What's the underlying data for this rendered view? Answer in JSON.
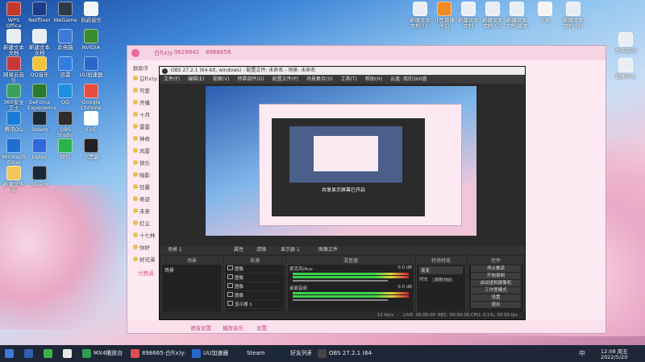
{
  "desktop": {
    "icons_left": [
      {
        "label": "WPS Office",
        "color": "#c0392b"
      },
      {
        "label": "Netflixer",
        "color": "#1e3a8a"
      },
      {
        "label": "WeGame",
        "color": "#2d3a4a"
      },
      {
        "label": "自启音乐",
        "color": "#f5f5f5"
      },
      {
        "label": "新建文本文档",
        "color": "#e9eef5"
      },
      {
        "label": "新建文本文档",
        "color": "#e9eef5"
      },
      {
        "label": "此电脑",
        "color": "#3e7bd6"
      },
      {
        "label": "NVIDIA",
        "color": "#3b8b2f"
      },
      {
        "label": "网易云音乐",
        "color": "#c83a3a"
      },
      {
        "label": "QQ音乐",
        "color": "#f3c33d"
      },
      {
        "label": "迅雷",
        "color": "#2f7de0"
      },
      {
        "label": "UU加速器",
        "color": "#2a67c9"
      },
      {
        "label": "360安全卫士",
        "color": "#3aa05a"
      },
      {
        "label": "GeForce Experience",
        "color": "#2b7a2b"
      },
      {
        "label": "QQ",
        "color": "#1d8fe0"
      },
      {
        "label": "Google Chrome",
        "color": "#e74c3c"
      },
      {
        "label": "腾讯QQ",
        "color": "#1a7ad9"
      },
      {
        "label": "Steam",
        "color": "#1b2838"
      },
      {
        "label": "OBS Studio",
        "color": "#2c2c2c"
      },
      {
        "label": "EVE",
        "color": "#ffffff"
      },
      {
        "label": "Microsoft Edge",
        "color": "#1f6fd1"
      },
      {
        "label": "Uplay",
        "color": "#3168d8"
      },
      {
        "label": "微信",
        "color": "#2bb24c"
      },
      {
        "label": "小黑盒",
        "color": "#222"
      },
      {
        "label": "新建文件夹",
        "color": "#f1c75a"
      },
      {
        "label": "Steam",
        "color": "#1b2838"
      }
    ],
    "icons_right": [
      {
        "label": "新建文本文档 (3)",
        "color": "#e9eef5"
      },
      {
        "label": "斗鱼直播伴侣",
        "color": "#f08a24"
      },
      {
        "label": "新建文本文档",
        "color": "#e9eef5"
      },
      {
        "label": "新建文本文档 (2)",
        "color": "#e9eef5"
      },
      {
        "label": "新建文本文档 副本",
        "color": "#e9eef5"
      },
      {
        "label": "下载",
        "color": "#f5f5f5"
      },
      {
        "label": "新建文本文档 (2)",
        "color": "#e9eef5"
      },
      {
        "label": "显卡驱动",
        "color": "#e9eef5"
      },
      {
        "label": "直播中心",
        "color": "#e9eef5"
      }
    ],
    "watermark_number": "9629842"
  },
  "chat_window": {
    "title_name": "白f(x)y",
    "room_id": "9629842",
    "room_id2": "898665",
    "count_a": "6",
    "sidebar_title": "群助手",
    "sidebar_items": [
      "白f(x)y: 9629842",
      "可爱",
      "开播",
      "十月",
      "雷雷",
      "神奇",
      "风雷",
      "快乐",
      "暗影",
      "狂暴",
      "奇迹",
      "未来",
      "红尘",
      "十七林",
      "你好",
      "好兄弟"
    ],
    "bottom_buttons": [
      "语音设置",
      "播放音乐",
      "设置"
    ],
    "pink_label": "付费通"
  },
  "obs": {
    "title": "OBS 27.2.1 (64-bit, windows) - 配置文件: 未命名 - 场景: 未命名",
    "menu": [
      "文件(F)",
      "编辑(E)",
      "视图(V)",
      "停靠部件(D)",
      "配置文件(P)",
      "场景集合(S)",
      "工具(T)",
      "帮助(H)",
      "云盘: 我的360盘"
    ],
    "preview_overlay": "共享显示屏幕已开启",
    "dock_bar": {
      "scene": "场景 1",
      "props": "属性",
      "filters": "滤镜",
      "source": "显示器 1",
      "image_file": "图像文件"
    },
    "docks": {
      "scenes_header": "场景",
      "scenes": [
        "场景"
      ],
      "sources_header": "来源",
      "sources": [
        "图像",
        "图像",
        "图像",
        "图像",
        "显示器 1"
      ],
      "mixer_header": "混音器",
      "mixer_tracks": [
        {
          "name": "麦克风/Aux",
          "db": "0.0 dB"
        },
        {
          "name": "桌面音频",
          "db": "0.0 dB"
        }
      ],
      "transitions_header": "转场特效",
      "transition": "渐变",
      "duration_label": "时长",
      "duration_value": "300 ms",
      "controls_header": "控件",
      "controls": [
        "停止推流",
        "开始录制",
        "启动虚拟摄像机",
        "工作室模式",
        "设置",
        "退出"
      ]
    },
    "status": {
      "live": "LIVE: 00:00:00",
      "rec": "REC: 00:00:00",
      "cpu": "CPU: 3.1%, 30.00 fps",
      "bitrate": "12 kb/s"
    }
  },
  "taskbar": {
    "items": [
      {
        "label": "",
        "color": "#3b7ad9"
      },
      {
        "label": "",
        "color": "#2f5fb0"
      },
      {
        "label": "",
        "color": "#3bb34a"
      },
      {
        "label": "",
        "color": "#e8e8e8"
      },
      {
        "label": "MX4播放台",
        "color": "#2f9e4e"
      },
      {
        "label": "898665-白f(x)y: 9...",
        "color": "#d94e4e"
      },
      {
        "label": "UU加速器",
        "color": "#2a67c9"
      },
      {
        "label": "Steam",
        "color": "#1b2838"
      },
      {
        "label": "好友列表",
        "color": "#1b2838"
      },
      {
        "label": "OBS 27.2.1 (64-bi...",
        "color": "#444"
      }
    ],
    "tray_text": "中",
    "time": "12:08 周五",
    "date": "2022/5/20"
  }
}
